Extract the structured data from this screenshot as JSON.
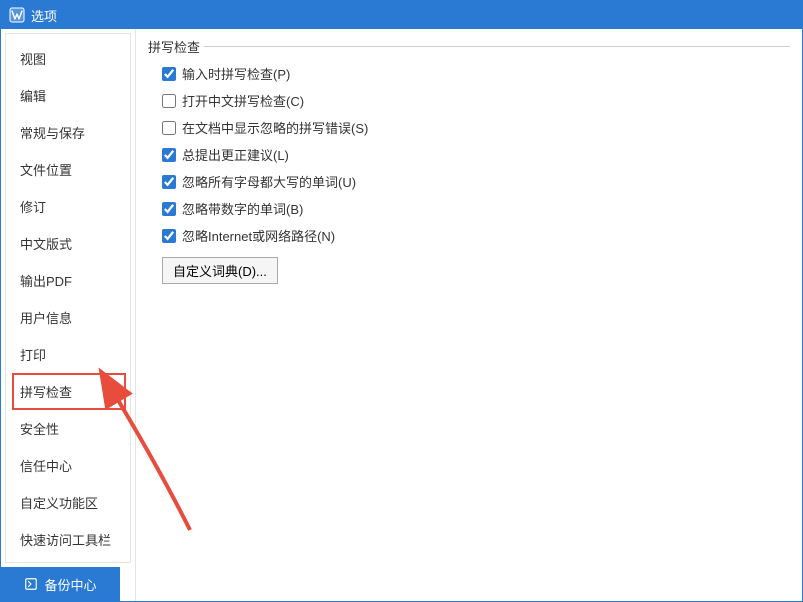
{
  "titlebar": {
    "title": "选项",
    "app_icon_name": "app-icon"
  },
  "sidebar": {
    "items": [
      {
        "label": "视图",
        "selected": false
      },
      {
        "label": "编辑",
        "selected": false
      },
      {
        "label": "常规与保存",
        "selected": false
      },
      {
        "label": "文件位置",
        "selected": false
      },
      {
        "label": "修订",
        "selected": false
      },
      {
        "label": "中文版式",
        "selected": false
      },
      {
        "label": "输出PDF",
        "selected": false
      },
      {
        "label": "用户信息",
        "selected": false
      },
      {
        "label": "打印",
        "selected": false
      },
      {
        "label": "拼写检查",
        "selected": true
      },
      {
        "label": "安全性",
        "selected": false
      },
      {
        "label": "信任中心",
        "selected": false
      },
      {
        "label": "自定义功能区",
        "selected": false
      },
      {
        "label": "快速访问工具栏",
        "selected": false
      }
    ]
  },
  "content": {
    "group_title": "拼写检查",
    "options": [
      {
        "label": "输入时拼写检查(P)",
        "checked": true
      },
      {
        "label": "打开中文拼写检查(C)",
        "checked": false
      },
      {
        "label": "在文档中显示忽略的拼写错误(S)",
        "checked": false
      },
      {
        "label": "总提出更正建议(L)",
        "checked": true
      },
      {
        "label": "忽略所有字母都大写的单词(U)",
        "checked": true
      },
      {
        "label": "忽略带数字的单词(B)",
        "checked": true
      },
      {
        "label": "忽略Internet或网络路径(N)",
        "checked": true
      }
    ],
    "custom_dict_button": "自定义词典(D)..."
  },
  "bottombar": {
    "backup_label": "备份中心"
  }
}
